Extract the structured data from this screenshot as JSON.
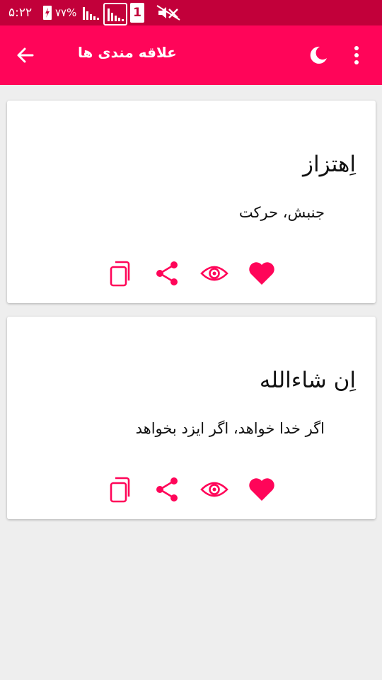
{
  "status_bar": {
    "time": "۵:۲۲",
    "battery_percent": "۷۷%",
    "sim_label": "1",
    "icons": [
      "battery-charging-icon",
      "signal-icon",
      "signal-icon",
      "sim-icon",
      "mute-icon"
    ]
  },
  "app_bar": {
    "title": "علاقه مندی ها",
    "back_icon": "arrow-back-icon",
    "night_mode_icon": "moon-icon",
    "menu_icon": "more-vert-icon"
  },
  "cards": [
    {
      "word": "اِهتزاز",
      "meaning": "جنبش، حرکت"
    },
    {
      "word": "اِن شاءالله",
      "meaning": "اگر خدا خواهد، اگر ایزد بخواهد"
    }
  ],
  "card_actions": [
    "copy-icon",
    "share-icon",
    "view-icon",
    "favorite-icon"
  ],
  "colors": {
    "status_bar": "#c2003a",
    "app_bar": "#ff0559",
    "accent": "#ff0559",
    "background": "#eeeeee",
    "card": "#ffffff"
  }
}
